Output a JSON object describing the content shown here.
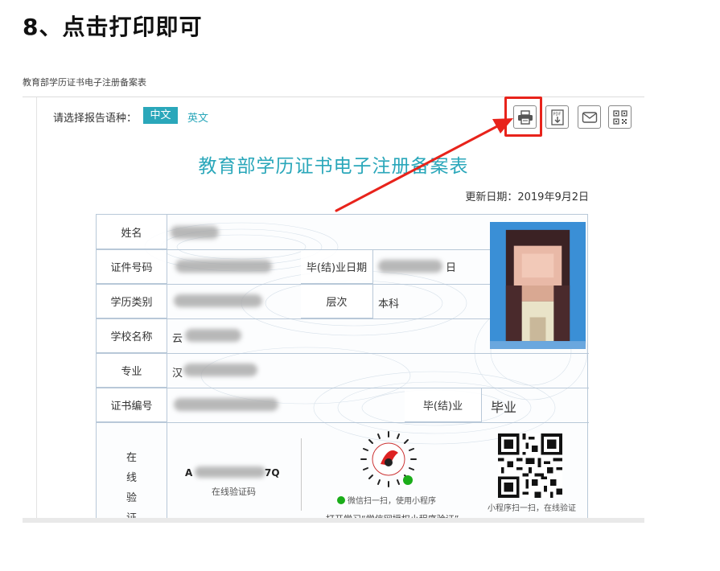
{
  "step_title": "8、点击打印即可",
  "page": {
    "title": "教育部学历证书电子注册备案表",
    "lang_label": "请选择报告语种：",
    "lang_cn": "中文",
    "lang_en": "英文",
    "toolbar": [
      {
        "icon": "print-icon",
        "highlighted": true
      },
      {
        "icon": "pdf-download-icon",
        "highlighted": false
      },
      {
        "icon": "mail-icon",
        "highlighted": false
      },
      {
        "icon": "qrcode-icon",
        "highlighted": false
      }
    ],
    "highlight_color": "#e8231b",
    "accent_color": "#2aa7ba"
  },
  "report": {
    "title": "教育部学历证书电子注册备案表",
    "update_date": "更新日期：2019年9月2日",
    "fields": {
      "name_label": "姓名",
      "id_label": "证件号码",
      "grad_date_label": "毕(结)业日期",
      "grad_date_suffix": "日",
      "edu_type_label": "学历类别",
      "level_label": "层次",
      "level_value": "本科",
      "school_label": "学校名称",
      "school_prefix": "云",
      "major_label": "专业",
      "major_prefix": "汉",
      "cert_no_label": "证书编号",
      "grad_status_label": "毕(结)业",
      "grad_status_value": "毕业"
    },
    "verify": {
      "label_chars": [
        "在",
        "线",
        "验",
        "证"
      ],
      "code_prefix": "A",
      "code_suffix": "7Q",
      "code_caption": "在线验证码",
      "wechat_note": "微信扫一扫，使用小程序",
      "cut_text": "打开学习“学信网授权小程序验证”",
      "qr_note": "小程序扫一扫，在线验证"
    }
  }
}
